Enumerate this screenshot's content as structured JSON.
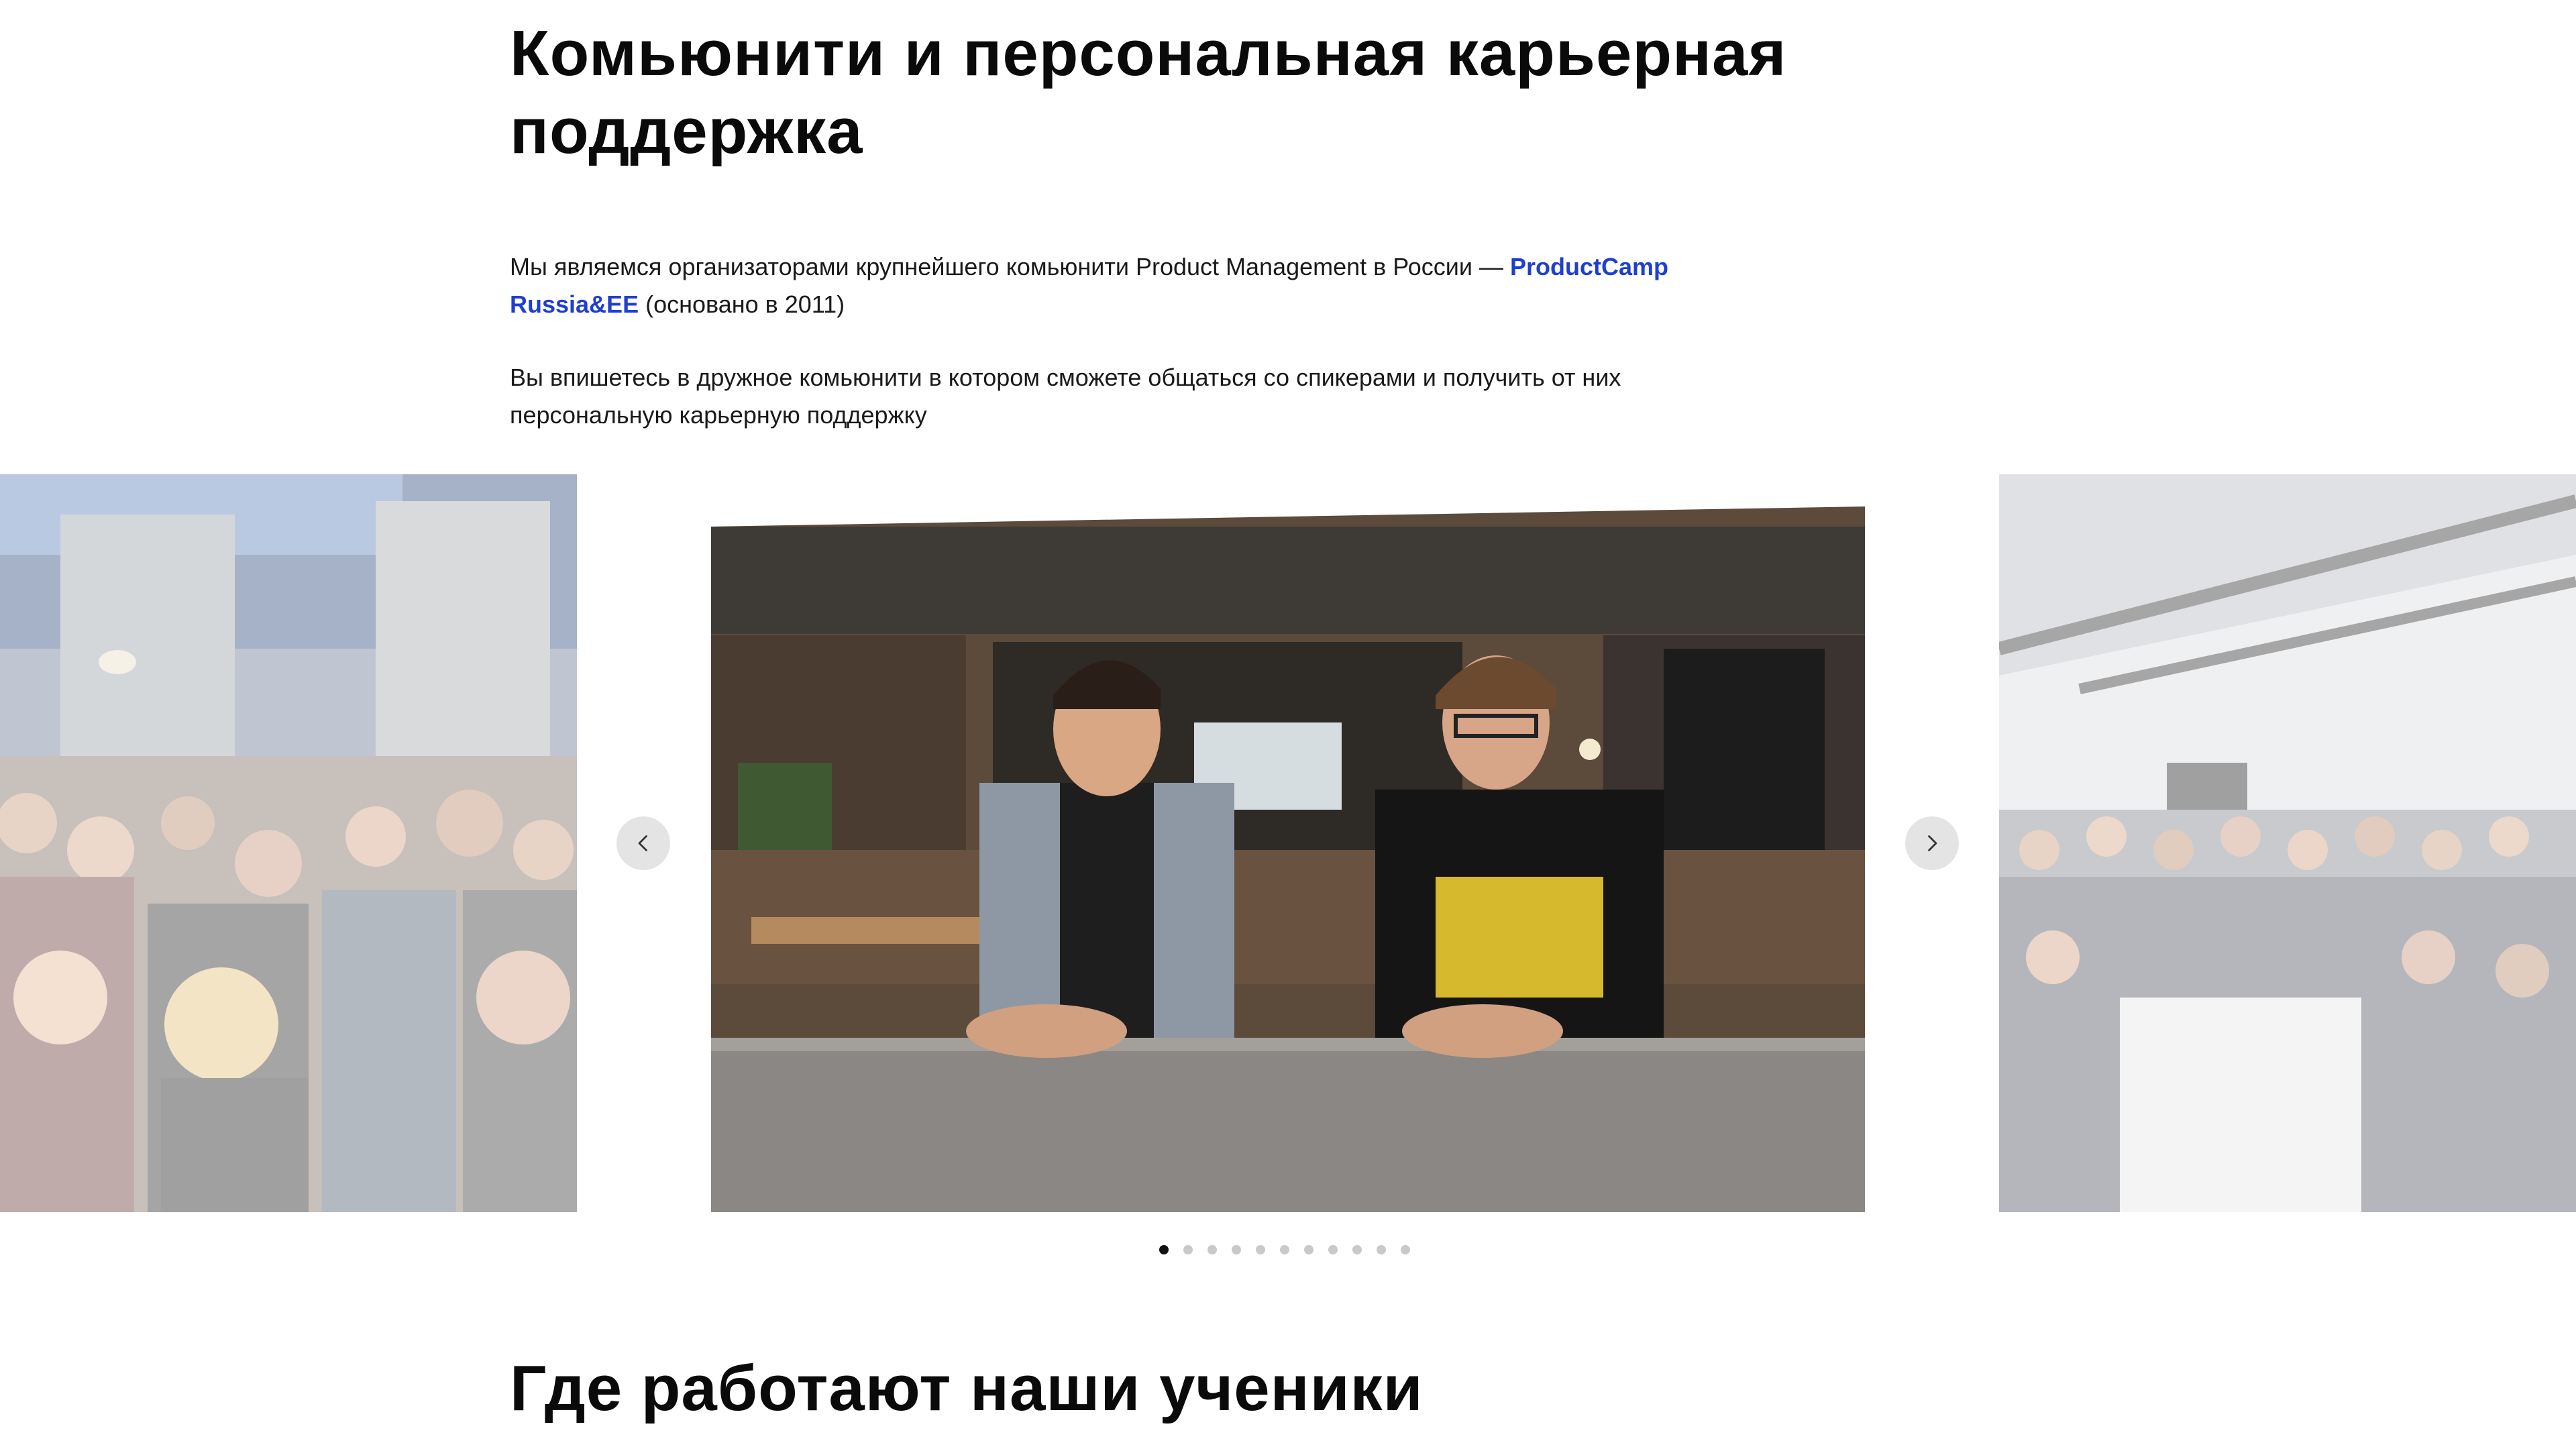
{
  "community_section": {
    "title": "Комьюнити и персональная карьерная поддержка",
    "paragraph_1": {
      "before_link": "Мы являемся организаторами крупнейшего комьюнити Product Management в России — ",
      "link_text": "ProductCamp Russia&EE",
      "after_link": " (основано в 2011)"
    },
    "paragraph_2": "Вы впишетесь в дружное комьюнити в котором сможете общаться со спикерами и получить от них персональную карьерную поддержку"
  },
  "carousel": {
    "slides": [
      "conference-audience-photo",
      "two-speakers-photo",
      "group-photo"
    ],
    "active_slide": 1,
    "dot_count": 11,
    "prev_icon": "chevron-left-icon",
    "next_icon": "chevron-right-icon"
  },
  "students_section": {
    "title": "Где работают наши ученики"
  },
  "colors": {
    "link": "#1f3fd1",
    "text": "#1a1a1a",
    "dot_active": "#111111",
    "dot_inactive": "#c9c9c9",
    "arrow_bg": "#e4e4e4"
  }
}
